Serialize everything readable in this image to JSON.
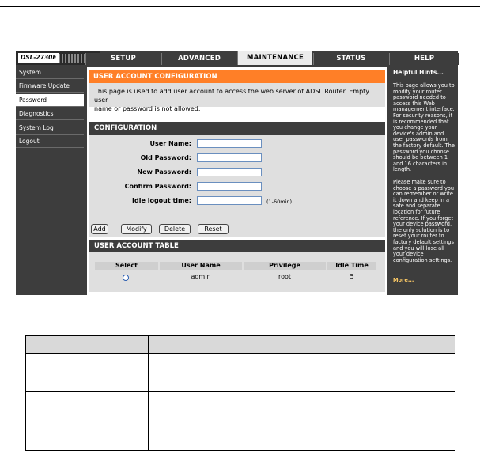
{
  "router": {
    "logo_text": "DSL-2730E",
    "tabs": [
      {
        "label": "SETUP"
      },
      {
        "label": "ADVANCED"
      },
      {
        "label": "MAINTENANCE"
      },
      {
        "label": "STATUS"
      },
      {
        "label": "HELP"
      }
    ],
    "active_tab": "MAINTENANCE",
    "sidebar": [
      {
        "label": "System"
      },
      {
        "label": "Firmware Update"
      },
      {
        "label": "Password"
      },
      {
        "label": "Diagnostics"
      },
      {
        "label": "System Log"
      },
      {
        "label": "Logout"
      }
    ],
    "active_sidebar": "Password"
  },
  "user_account_config": {
    "title": "USER ACCOUNT CONFIGURATION",
    "description_line1": "This page is used to add user account to access the web server of ADSL Router. Empty user",
    "description_line2": "name or password is not allowed."
  },
  "configuration": {
    "title": "CONFIGURATION",
    "fields": [
      {
        "label": "User Name:",
        "value": ""
      },
      {
        "label": "Old Password:",
        "value": ""
      },
      {
        "label": "New Password:",
        "value": ""
      },
      {
        "label": "Confirm Password:",
        "value": ""
      },
      {
        "label": "Idle logout time:",
        "value": ""
      }
    ],
    "idle_hint": "(1-60min)",
    "buttons": {
      "add": "Add",
      "modify": "Modify",
      "delete": "Delete",
      "reset": "Reset"
    }
  },
  "user_table": {
    "title": "USER ACCOUNT TABLE",
    "headers": [
      "Select",
      "User Name",
      "Privilege",
      "Idle Time"
    ],
    "rows": [
      {
        "user_name": "admin",
        "privilege": "root",
        "idle_time": "5"
      }
    ]
  },
  "help": {
    "title": "Helpful Hints...",
    "para1": "This page allows you to modify your router password needed to access this Web management interface. For security reasons, it is recommended that you change your device's admin and user passwords from the factory default. The password you choose should be between 1 and 16 characters in length.",
    "para2": "Please make sure to choose a password you can remember or write it down and keep in a safe and separate location for future reference. If you forget your device password, the only solution is to reset your router to factory default settings and you will lose all your device configuration settings.",
    "more": "More..."
  }
}
